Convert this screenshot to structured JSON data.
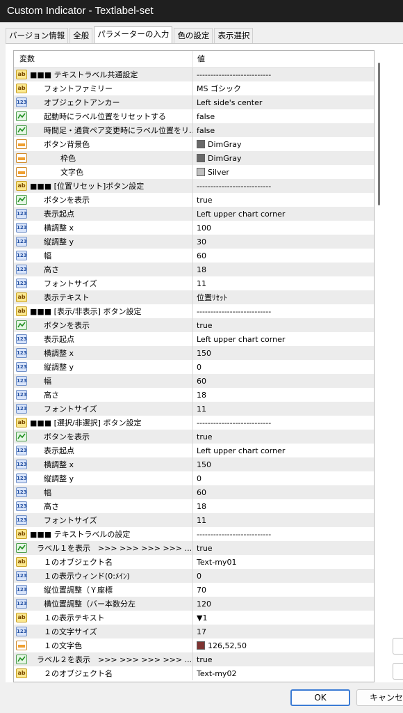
{
  "window": {
    "title": "Custom Indicator - Textlabel-set"
  },
  "tabs": [
    {
      "label": "バージョン情報"
    },
    {
      "label": "全般"
    },
    {
      "label": "パラメーターの入力"
    },
    {
      "label": "色の設定"
    },
    {
      "label": "表示選択"
    }
  ],
  "active_tab": "パラメーターの入力",
  "grid": {
    "col_variable": "変数",
    "col_value": "値",
    "rows": [
      {
        "icon": "ab",
        "indent": 0,
        "name": "■■■ テキストラベル共通設定",
        "value": "---------------------------"
      },
      {
        "icon": "ab",
        "indent": 2,
        "name": "フォントファミリー",
        "value": "MS ゴシック"
      },
      {
        "icon": "num",
        "indent": 2,
        "name": "オブジェクトアンカー",
        "value": "Left side's center"
      },
      {
        "icon": "bool",
        "indent": 2,
        "name": "起動時にラベル位置をリセットする",
        "value": "false"
      },
      {
        "icon": "bool",
        "indent": 2,
        "name": "時間足・通貨ペア変更時にラベル位置をリ...",
        "value": "false"
      },
      {
        "icon": "color",
        "indent": 2,
        "name": "ボタン背景色",
        "value": "DimGray",
        "swatch": "#696969"
      },
      {
        "icon": "color",
        "indent": 4,
        "name": "枠色",
        "value": "DimGray",
        "swatch": "#696969"
      },
      {
        "icon": "color",
        "indent": 4,
        "name": "文字色",
        "value": "Silver",
        "swatch": "#c0c0c0"
      },
      {
        "icon": "ab",
        "indent": 0,
        "name": "■■■ [位置リセット]ボタン設定",
        "value": "---------------------------"
      },
      {
        "icon": "bool",
        "indent": 2,
        "name": "ボタンを表示",
        "value": "true"
      },
      {
        "icon": "num",
        "indent": 2,
        "name": "表示起点",
        "value": "Left upper chart corner"
      },
      {
        "icon": "num",
        "indent": 2,
        "name": "横調整 x",
        "value": "100"
      },
      {
        "icon": "num",
        "indent": 2,
        "name": "縦調整 y",
        "value": "30"
      },
      {
        "icon": "num",
        "indent": 2,
        "name": "幅",
        "value": "60"
      },
      {
        "icon": "num",
        "indent": 2,
        "name": "高さ",
        "value": "18"
      },
      {
        "icon": "num",
        "indent": 2,
        "name": "フォントサイズ",
        "value": "11"
      },
      {
        "icon": "ab",
        "indent": 2,
        "name": "表示テキスト",
        "value": "位置ﾘｾｯﾄ"
      },
      {
        "icon": "ab",
        "indent": 0,
        "name": "■■■ [表示/非表示] ボタン設定",
        "value": "---------------------------"
      },
      {
        "icon": "bool",
        "indent": 2,
        "name": "ボタンを表示",
        "value": "true"
      },
      {
        "icon": "num",
        "indent": 2,
        "name": "表示起点",
        "value": "Left upper chart corner"
      },
      {
        "icon": "num",
        "indent": 2,
        "name": "横調整 x",
        "value": "150"
      },
      {
        "icon": "num",
        "indent": 2,
        "name": "縦調整 y",
        "value": "0"
      },
      {
        "icon": "num",
        "indent": 2,
        "name": "幅",
        "value": "60"
      },
      {
        "icon": "num",
        "indent": 2,
        "name": "高さ",
        "value": "18"
      },
      {
        "icon": "num",
        "indent": 2,
        "name": "フォントサイズ",
        "value": "11"
      },
      {
        "icon": "ab",
        "indent": 0,
        "name": "■■■ [選択/非選択] ボタン設定",
        "value": "---------------------------"
      },
      {
        "icon": "bool",
        "indent": 2,
        "name": "ボタンを表示",
        "value": "true"
      },
      {
        "icon": "num",
        "indent": 2,
        "name": "表示起点",
        "value": "Left upper chart corner"
      },
      {
        "icon": "num",
        "indent": 2,
        "name": "横調整 x",
        "value": "150"
      },
      {
        "icon": "num",
        "indent": 2,
        "name": "縦調整 y",
        "value": "0"
      },
      {
        "icon": "num",
        "indent": 2,
        "name": "幅",
        "value": "60"
      },
      {
        "icon": "num",
        "indent": 2,
        "name": "高さ",
        "value": "18"
      },
      {
        "icon": "num",
        "indent": 2,
        "name": "フォントサイズ",
        "value": "11"
      },
      {
        "icon": "ab",
        "indent": 0,
        "name": "■■■ テキストラベルの設定",
        "value": "---------------------------"
      },
      {
        "icon": "bool",
        "indent": 1,
        "name": "ラベル１を表示　>>>  >>>  >>>  >>> ...",
        "value": "true"
      },
      {
        "icon": "ab",
        "indent": 2,
        "name": "１のオブジェクト名",
        "value": "Text-my01"
      },
      {
        "icon": "num",
        "indent": 2,
        "name": "１の表示ウィンド(0:ﾒｲﾝ)",
        "value": "0"
      },
      {
        "icon": "num",
        "indent": 2,
        "name": "縦位置調整（Ｙ座標",
        "value": "70"
      },
      {
        "icon": "num",
        "indent": 2,
        "name": "横位置調整（バー本数分左",
        "value": "120"
      },
      {
        "icon": "ab",
        "indent": 2,
        "name": "１の表示テキスト",
        "value": "▼1"
      },
      {
        "icon": "num",
        "indent": 2,
        "name": "１の文字サイズ",
        "value": "17"
      },
      {
        "icon": "color",
        "indent": 2,
        "name": "１の文字色",
        "value": "126,52,50",
        "swatch": "#7e3432"
      },
      {
        "icon": "bool",
        "indent": 1,
        "name": "ラベル２を表示　>>>  >>>  >>>  >>> ...",
        "value": "true"
      },
      {
        "icon": "ab",
        "indent": 2,
        "name": "２のオブジェクト名",
        "value": "Text-my02"
      }
    ]
  },
  "buttons": {
    "ok": "OK",
    "cancel": "キャンセル"
  }
}
